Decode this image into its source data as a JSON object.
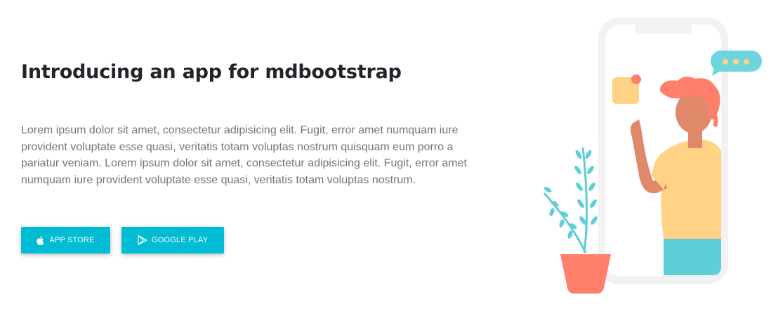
{
  "hero": {
    "title": "Introducing an app for mdbootstrap",
    "description": "Lorem ipsum dolor sit amet, consectetur adipisicing elit. Fugit, error amet numquam iure provident voluptate esse quasi, veritatis totam voluptas nostrum quisquam eum porro a pariatur veniam. Lorem ipsum dolor sit amet, consectetur adipisicing elit. Fugit, error amet numquam iure provident voluptate esse quasi, veritatis totam voluptas nostrum."
  },
  "buttons": {
    "app_store": {
      "label": "APP STORE",
      "icon": "apple-icon"
    },
    "google_play": {
      "label": "GOOGLE PLAY",
      "icon": "google-play-icon"
    }
  },
  "colors": {
    "button": "#00bcd4",
    "title": "#212529",
    "body_text": "#757575",
    "phone_frame": "#f2f2f2",
    "chat_bubble": "#6dd6dd",
    "hair": "#ff7f6b",
    "skin": "#e0896a",
    "shirt": "#ffd285",
    "pants": "#5ecfd8",
    "pot": "#ff7f6b",
    "leaves": "#5ecfd8"
  }
}
